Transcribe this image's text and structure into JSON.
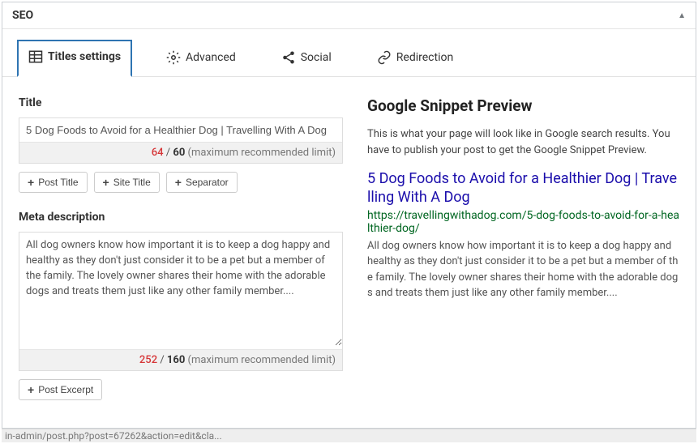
{
  "panel": {
    "title": "SEO"
  },
  "tabs": {
    "titles": "Titles settings",
    "advanced": "Advanced",
    "social": "Social",
    "redirection": "Redirection"
  },
  "title_section": {
    "label": "Title",
    "value": "5 Dog Foods to Avoid for a Healthier Dog | Travelling With A Dog",
    "count": "64",
    "limit": "60",
    "note": "(maximum recommended limit)",
    "buttons": {
      "post_title": "Post Title",
      "site_title": "Site Title",
      "separator": "Separator"
    }
  },
  "meta_section": {
    "label": "Meta description",
    "value": "All dog owners know how important it is to keep a dog happy and healthy as they don't just consider it to be a pet but a member of the family. The lovely owner shares their home with the adorable dogs and treats them just like any other family member....",
    "count": "252",
    "limit": "160",
    "note": "(maximum recommended limit)",
    "buttons": {
      "post_excerpt": "Post Excerpt"
    }
  },
  "preview": {
    "heading": "Google Snippet Preview",
    "note": "This is what your page will look like in Google search results. You have to publish your post to get the Google Snippet Preview.",
    "title": "5 Dog Foods to Avoid for a Healthier Dog | Travelling With A Dog",
    "url": "https://travellingwithadog.com/5-dog-foods-to-avoid-for-a-healthier-dog/",
    "desc": "All dog owners know how important it is to keep a dog happy and healthy as they don't just consider it to be a pet but a member of the family. The lovely owner shares their home with the adorable dogs and treats them just like any other family member...."
  },
  "status_bar": "in-admin/post.php?post=67262&action=edit&cla..."
}
